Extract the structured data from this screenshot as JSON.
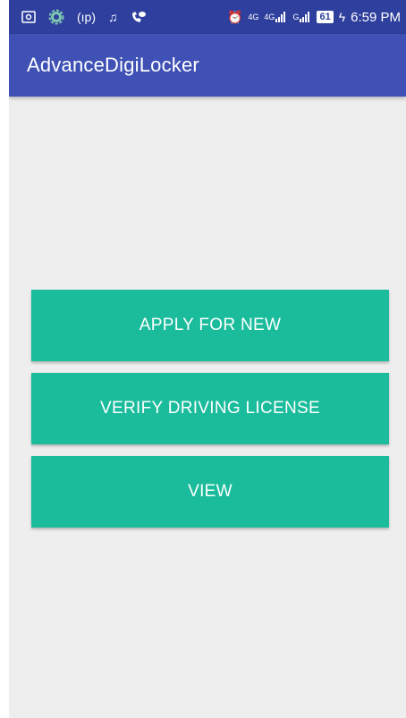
{
  "status_bar": {
    "left_icons": [
      "screenshot-icon",
      "settings-gear-icon",
      "hotspot-icon",
      "music-icon",
      "call-icon"
    ],
    "network_label": "4G",
    "signal1": "4G",
    "signal2": "G",
    "battery": "61",
    "time": "6:59 PM"
  },
  "app_bar": {
    "title": "AdvanceDigiLocker"
  },
  "buttons": {
    "apply": "APPLY FOR NEW",
    "verify": "VERIFY DRIVING LICENSE",
    "view": "VIEW"
  },
  "colors": {
    "status_bar": "#2f3f9e",
    "app_bar": "#3f51b5",
    "button": "#1abc9c",
    "background": "#eeeeee"
  }
}
